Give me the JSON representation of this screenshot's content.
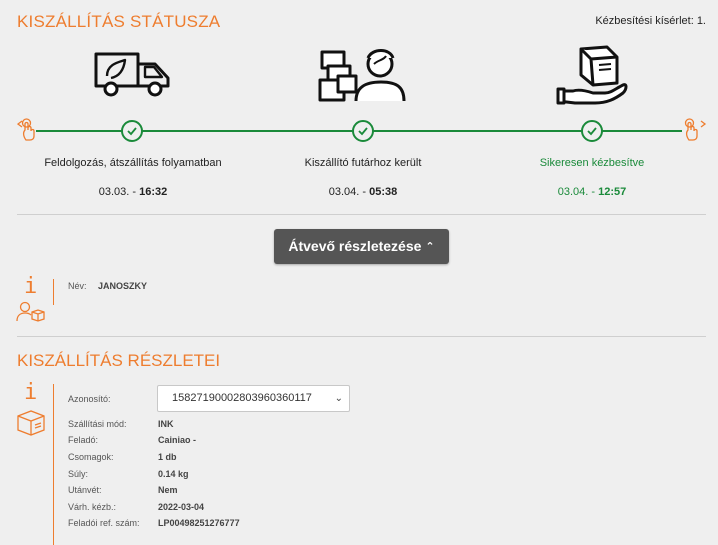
{
  "header": {
    "title": "KISZÁLLÍTÁS STÁTUSZA",
    "attempt_text": "Kézbesítési kísérlet: 1."
  },
  "colors": {
    "accent": "#ee7d2f",
    "success": "#1a8a3a",
    "button": "#555555"
  },
  "steps": [
    {
      "icon": "delivery-truck-icon",
      "label": "Feldolgozás, átszállítás folyamatban",
      "date": "03.03. - ",
      "time": "16:32",
      "state": "done"
    },
    {
      "icon": "courier-with-parcels-icon",
      "label": "Kiszállító futárhoz került",
      "date": "03.04. - ",
      "time": "05:38",
      "state": "done"
    },
    {
      "icon": "parcel-in-hand-icon",
      "label": "Sikeresen kézbesítve",
      "date": "03.04. - ",
      "time": "12:57",
      "state": "final"
    }
  ],
  "receiver": {
    "button_label": "Átvevő részletezése",
    "name_label": "Név:",
    "name_value": "JANOSZKY"
  },
  "details": {
    "title": "KISZÁLLÍTÁS RÉSZLETEI",
    "id_label": "Azonosító:",
    "id_selected": "15827190002803960360117",
    "rows": [
      {
        "label": "Szállítási mód:",
        "value": "INK"
      },
      {
        "label": "Feladó:",
        "value": "Cainiao -"
      },
      {
        "label": "Csomagok:",
        "value": "1 db"
      },
      {
        "label": "Súly:",
        "value": "0.14 kg"
      },
      {
        "label": "Utánvét:",
        "value": "Nem"
      },
      {
        "label": "Várh. kézb.:",
        "value": "2022-03-04"
      },
      {
        "label": "Feladói ref. szám:",
        "value": "LP00498251276777"
      }
    ]
  }
}
